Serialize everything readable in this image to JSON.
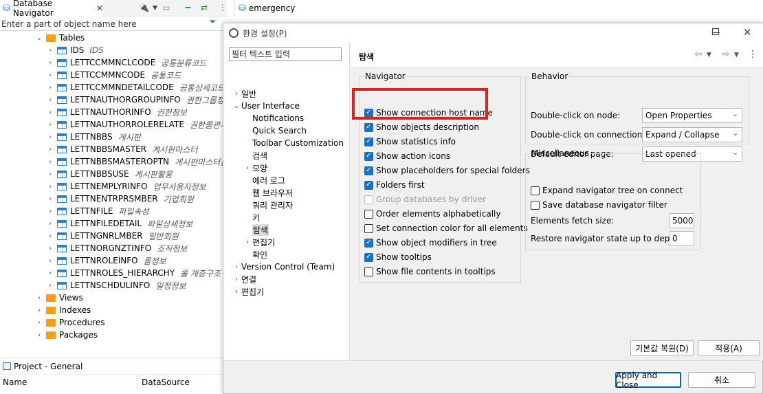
{
  "navigator": {
    "tab_label": "Database Navigator",
    "filter_placeholder": "Enter a part of object name here",
    "tree": {
      "tables_label": "Tables",
      "tables": [
        {
          "name": "IDS",
          "desc": "IDS"
        },
        {
          "name": "LETTCCMMNCLCODE",
          "desc": "공통분류코드"
        },
        {
          "name": "LETTCCMMNCODE",
          "desc": "공통코드"
        },
        {
          "name": "LETTCCMMNDETAILCODE",
          "desc": "공통상세코드"
        },
        {
          "name": "LETTNAUTHORGROUPINFO",
          "desc": "권한그룹정보"
        },
        {
          "name": "LETTNAUTHORINFO",
          "desc": "권한정보"
        },
        {
          "name": "LETTNAUTHORROLERELATE",
          "desc": "권한롤관계"
        },
        {
          "name": "LETTNBBS",
          "desc": "게시판"
        },
        {
          "name": "LETTNBBSMASTER",
          "desc": "게시판마스터"
        },
        {
          "name": "LETTNBBSMASTEROPTN",
          "desc": "게시판마스터옵션"
        },
        {
          "name": "LETTNBBSUSE",
          "desc": "게시판활용"
        },
        {
          "name": "LETTNEMPLYRINFO",
          "desc": "업무사용자정보"
        },
        {
          "name": "LETTNENTRPRSMBER",
          "desc": "기업회원"
        },
        {
          "name": "LETTNFILE",
          "desc": "파일속성"
        },
        {
          "name": "LETTNFILEDETAIL",
          "desc": "파일상세정보"
        },
        {
          "name": "LETTNGNRLMBER",
          "desc": "일반회원"
        },
        {
          "name": "LETTNORGNZTINFO",
          "desc": "조직정보"
        },
        {
          "name": "LETTNROLEINFO",
          "desc": "롤정보"
        },
        {
          "name": "LETTNROLES_HIERARCHY",
          "desc": "롤 계층구조"
        },
        {
          "name": "LETTNSCHDULINFO",
          "desc": "일정정보"
        }
      ],
      "folders": [
        "Views",
        "Indexes",
        "Procedures",
        "Packages"
      ]
    }
  },
  "project": {
    "tab_label": "Project - General",
    "col_name": "Name",
    "col_datasource": "DataSource"
  },
  "editor": {
    "tab_label": "emergency"
  },
  "dialog": {
    "title": "환경 설정(P)",
    "filter_placeholder": "필터 텍스트 입력",
    "categories": [
      {
        "label": "일반",
        "indent": 0,
        "chevron": "›"
      },
      {
        "label": "User Interface",
        "indent": 0,
        "chevron": "⌄"
      },
      {
        "label": "Notifications",
        "indent": 1,
        "chevron": ""
      },
      {
        "label": "Quick Search",
        "indent": 1,
        "chevron": ""
      },
      {
        "label": "Toolbar Customization",
        "indent": 1,
        "chevron": ""
      },
      {
        "label": "검색",
        "indent": 1,
        "chevron": ""
      },
      {
        "label": "모양",
        "indent": 1,
        "chevron": "›"
      },
      {
        "label": "에러 로그",
        "indent": 1,
        "chevron": ""
      },
      {
        "label": "웹 브라우저",
        "indent": 1,
        "chevron": ""
      },
      {
        "label": "쿼리 관리자",
        "indent": 1,
        "chevron": ""
      },
      {
        "label": "키",
        "indent": 1,
        "chevron": ""
      },
      {
        "label": "탐색",
        "indent": 1,
        "chevron": "",
        "selected": true
      },
      {
        "label": "편집기",
        "indent": 1,
        "chevron": "›"
      },
      {
        "label": "확인",
        "indent": 1,
        "chevron": ""
      },
      {
        "label": "Version Control (Team)",
        "indent": 0,
        "chevron": "›"
      },
      {
        "label": "연결",
        "indent": 0,
        "chevron": "›"
      },
      {
        "label": "편집기",
        "indent": 0,
        "chevron": "›"
      }
    ],
    "page_title": "탐색",
    "navigator_group": {
      "legend": "Navigator",
      "options": [
        {
          "label": "Show connection host name",
          "checked": true,
          "disabled": false
        },
        {
          "label": "Show objects description",
          "checked": true,
          "disabled": false
        },
        {
          "label": "Show statistics info",
          "checked": true,
          "disabled": false
        },
        {
          "label": "Show action icons",
          "checked": true,
          "disabled": false
        },
        {
          "label": "Show placeholders for special folders",
          "checked": true,
          "disabled": false
        },
        {
          "label": "Folders first",
          "checked": true,
          "disabled": false
        },
        {
          "label": "Group databases by driver",
          "checked": false,
          "disabled": true
        },
        {
          "label": "Order elements alphabetically",
          "checked": false,
          "disabled": false
        },
        {
          "label": "Set connection color for all elements",
          "checked": false,
          "disabled": false
        },
        {
          "label": "Show object modifiers in tree",
          "checked": true,
          "disabled": false
        },
        {
          "label": "Show tooltips",
          "checked": true,
          "disabled": false
        },
        {
          "label": "Show file contents in tooltips",
          "checked": false,
          "disabled": false
        }
      ]
    },
    "behavior_group": {
      "legend": "Behavior",
      "rows": [
        {
          "label": "Double-click on node:",
          "value": "Open Properties"
        },
        {
          "label": "Double-click on connection:",
          "value": "Expand / Collapse"
        },
        {
          "label": "Default editor page:",
          "value": "Last opened"
        }
      ]
    },
    "misc_group": {
      "legend": "Miscellaneous",
      "options": [
        {
          "label": "Expand navigator tree on connect",
          "checked": false
        },
        {
          "label": "Save database navigator filter",
          "checked": false
        }
      ],
      "fetch_label": "Elements fetch size:",
      "fetch_value": "5000",
      "restore_label": "Restore navigator state up to depth:",
      "restore_value": "0"
    },
    "buttons": {
      "restore_defaults": "기본값 복원(D)",
      "apply": "적용(A)",
      "apply_close": "Apply and Close",
      "cancel": "취소"
    }
  },
  "colors": {
    "highlight": "#e02020",
    "checkbox_checked": "#1a6fc9"
  }
}
